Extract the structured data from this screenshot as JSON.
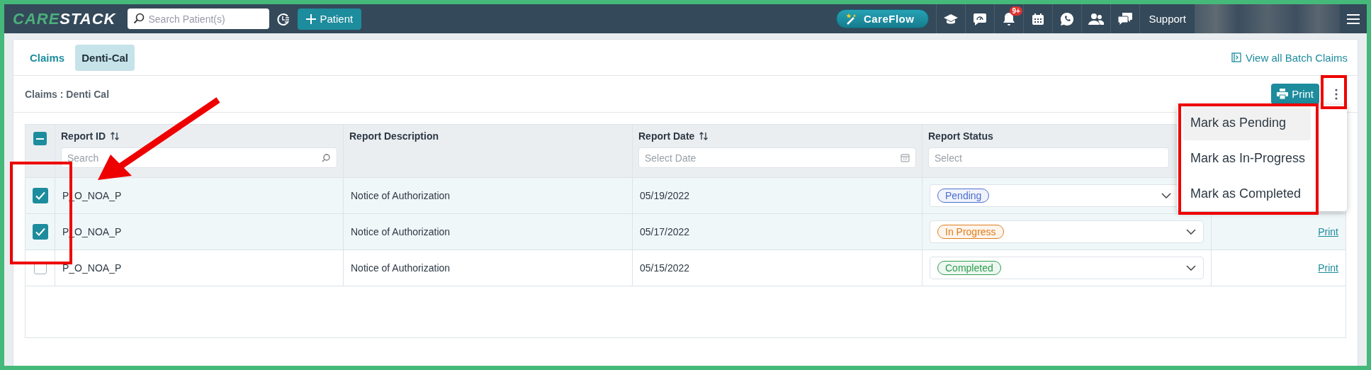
{
  "navbar": {
    "logo": {
      "part1": "CARE",
      "part2": "STACK"
    },
    "search": {
      "placeholder": "Search Patient(s)"
    },
    "add_button": "Patient",
    "careflow_button": "CareFlow",
    "notification_badge": "9+",
    "support": "Support"
  },
  "tabs": [
    {
      "label": "Claims",
      "selected": false
    },
    {
      "label": "Denti-Cal",
      "selected": true
    }
  ],
  "view_all_link": "View all Batch Claims",
  "section_title": "Claims : Denti Cal",
  "print_button": "Print",
  "table": {
    "select_all_indeterminate": true,
    "columns": [
      {
        "label": "Report ID",
        "sortable": true,
        "filter": {
          "kind": "search",
          "placeholder": "Search"
        }
      },
      {
        "label": "Report Description",
        "sortable": false
      },
      {
        "label": "Report Date",
        "sortable": true,
        "filter": {
          "kind": "date",
          "placeholder": "Select Date"
        }
      },
      {
        "label": "Report Status",
        "sortable": false,
        "filter": {
          "kind": "select",
          "placeholder": "Select"
        }
      }
    ],
    "rows": [
      {
        "checked": true,
        "report_id": "P_O_NOA_P",
        "description": "Notice of Authorization",
        "date": "05/19/2022",
        "status": {
          "label": "Pending",
          "color": "#4a6fd0"
        }
      },
      {
        "checked": true,
        "report_id": "P_O_NOA_P",
        "description": "Notice of Authorization",
        "date": "05/17/2022",
        "status": {
          "label": "In Progress",
          "color": "#e07d1a"
        },
        "action": "Print"
      },
      {
        "checked": false,
        "report_id": "P_O_NOA_P",
        "description": "Notice of Authorization",
        "date": "05/15/2022",
        "status": {
          "label": "Completed",
          "color": "#2e9e4f"
        },
        "action": "Print"
      }
    ]
  },
  "menu": [
    {
      "label": "Mark as Pending",
      "selected": true
    },
    {
      "label": "Mark as In-Progress",
      "selected": false
    },
    {
      "label": "Mark as Completed",
      "selected": false
    }
  ]
}
